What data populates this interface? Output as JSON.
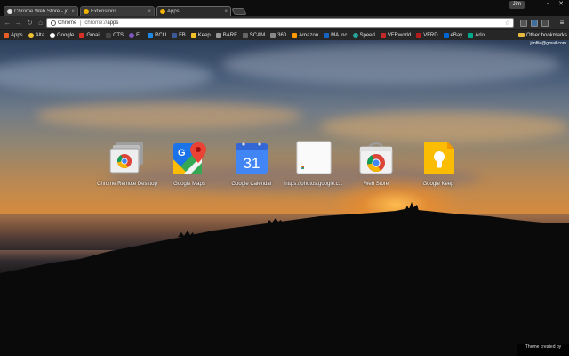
{
  "tabs": [
    {
      "title": "Chrome Web Store - jo",
      "favicon_color": "#e0e0e0",
      "active": false
    },
    {
      "title": "Extensions",
      "favicon_color": "#f4b400",
      "active": false
    },
    {
      "title": "Apps",
      "favicon_color": "#f4b400",
      "active": true
    }
  ],
  "window": {
    "profile_name": "Jim"
  },
  "toolbar": {
    "chip_label": "Chrome",
    "url_scheme": "chrome://",
    "url_path": "apps"
  },
  "bookmarks": {
    "items": [
      {
        "label": "Apps",
        "color": "#e85d28",
        "icon": "apps-grid-icon"
      },
      {
        "label": "Alta",
        "color": "#f1c232",
        "icon": "alta-icon"
      },
      {
        "label": "Google",
        "color": "#ffffff",
        "icon": "google-icon"
      },
      {
        "label": "Gmail",
        "color": "#d93025",
        "icon": "gmail-icon"
      },
      {
        "label": "CTS",
        "color": "#444444",
        "icon": "cts-icon"
      },
      {
        "label": "FL",
        "color": "#7e57c2",
        "icon": "fl-icon"
      },
      {
        "label": "RCU",
        "color": "#1e88e5",
        "icon": "rcu-icon"
      },
      {
        "label": "FB",
        "color": "#3b5998",
        "icon": "facebook-icon"
      },
      {
        "label": "Keep",
        "color": "#f6c026",
        "icon": "keep-icon"
      },
      {
        "label": "BARF",
        "color": "#999999",
        "icon": "barf-icon"
      },
      {
        "label": "SCAM",
        "color": "#666666",
        "icon": "scam-icon"
      },
      {
        "label": "360",
        "color": "#888888",
        "icon": "360-icon"
      },
      {
        "label": "Amazon",
        "color": "#ff9900",
        "icon": "amazon-icon"
      },
      {
        "label": "MA Inc",
        "color": "#1565c0",
        "icon": "ma-inc-icon"
      },
      {
        "label": "Speed",
        "color": "#26a69a",
        "icon": "speed-icon"
      },
      {
        "label": "VFRworld",
        "color": "#c62828",
        "icon": "vfrworld-icon"
      },
      {
        "label": "VFRD",
        "color": "#b71c1c",
        "icon": "vfrd-icon"
      },
      {
        "label": "eBay",
        "color": "#0064d2",
        "icon": "ebay-icon"
      },
      {
        "label": "Arlo",
        "color": "#00a88e",
        "icon": "arlo-icon"
      }
    ],
    "other_label": "Other bookmarks"
  },
  "content": {
    "account_email": "jimfile@gmail.com",
    "apps": [
      {
        "label": "Chrome Remote Desktop",
        "icon": "chrome-remote-desktop-icon"
      },
      {
        "label": "Google Maps",
        "icon": "google-maps-icon"
      },
      {
        "label": "Google Calendar",
        "icon": "google-calendar-icon",
        "day": "31"
      },
      {
        "label": "https://photos.google.c...",
        "icon": "google-photos-icon"
      },
      {
        "label": "Web Store",
        "icon": "chrome-web-store-icon"
      },
      {
        "label": "Google Keep",
        "icon": "google-keep-icon"
      }
    ],
    "theme_credit": "Theme created by"
  }
}
